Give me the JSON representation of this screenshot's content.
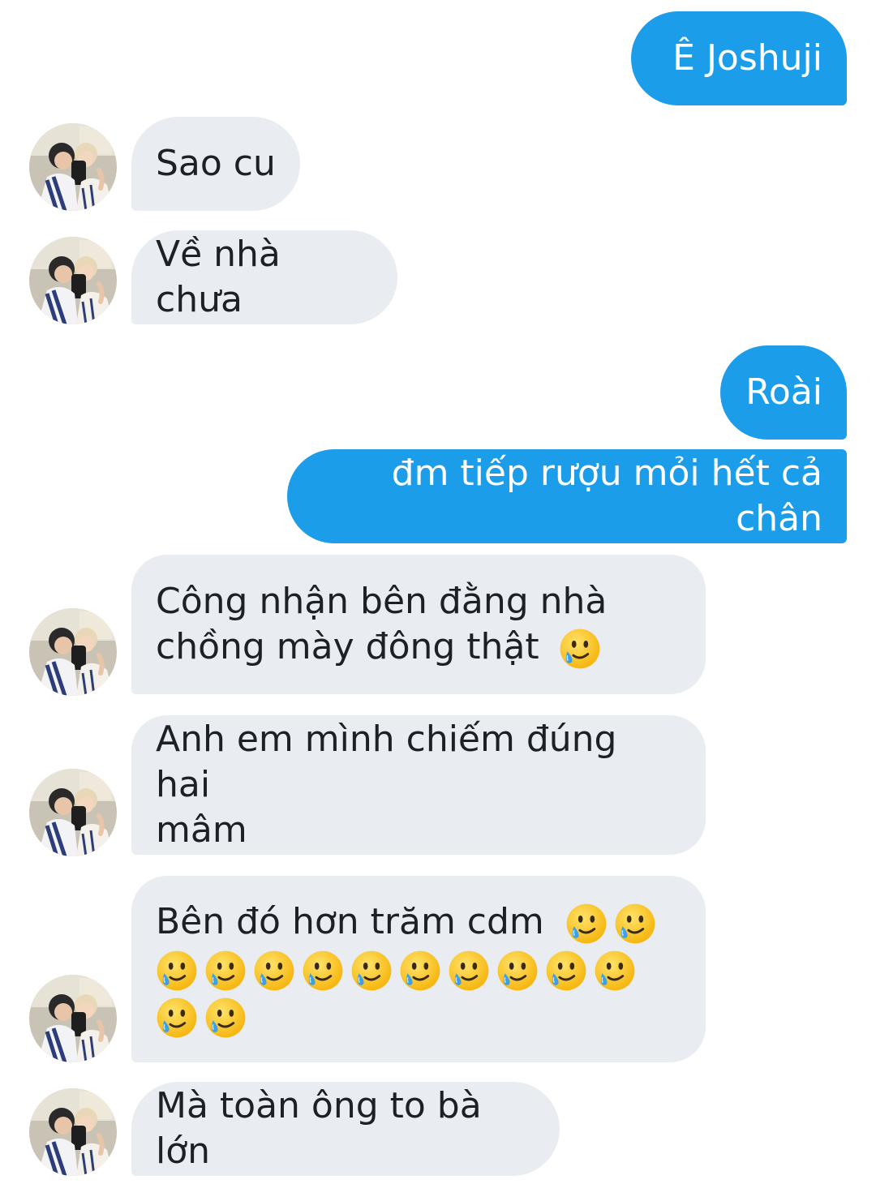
{
  "conversation": {
    "messages": [
      {
        "direction": "outgoing",
        "text": "Ê Joshuji"
      },
      {
        "direction": "incoming",
        "text": "Sao cu",
        "avatar": "contact-avatar"
      },
      {
        "direction": "incoming",
        "text": "Về nhà chưa",
        "avatar": "contact-avatar"
      },
      {
        "direction": "outgoing",
        "text": "Roài"
      },
      {
        "direction": "outgoing",
        "text": "đm tiếp rượu mỏi hết cả chân"
      },
      {
        "direction": "incoming",
        "line1": "Công nhận bên đằng nhà",
        "line2": "chồng mày đông thật",
        "emoji": "smiling-face-with-tear",
        "emoji_count": 1,
        "avatar": "contact-avatar"
      },
      {
        "direction": "incoming",
        "line1": "Anh em mình chiếm đúng hai",
        "line2": "mâm",
        "avatar": "contact-avatar"
      },
      {
        "direction": "incoming",
        "text": "Bên đó hơn trăm cdm",
        "emoji": "smiling-face-with-tear",
        "emoji_count": 14,
        "avatar": "contact-avatar"
      },
      {
        "direction": "incoming",
        "text": "Mà toàn ông to bà lớn",
        "avatar": "contact-avatar"
      }
    ]
  },
  "colors": {
    "outgoing_bubble": "#1c9dea",
    "incoming_bubble": "#e9ecf0",
    "incoming_text": "#1d2125",
    "outgoing_text": "#ffffff",
    "background": "#ffffff"
  }
}
